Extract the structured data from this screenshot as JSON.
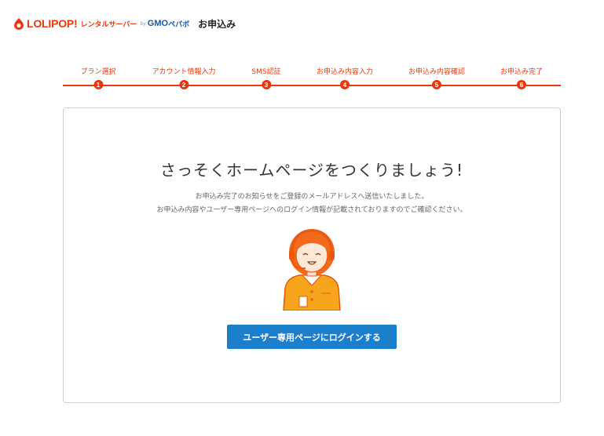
{
  "header": {
    "logo_main": "LOLIPOP!",
    "logo_sub": "レンタルサーバー",
    "logo_by": "by",
    "logo_gmo": "GMO",
    "logo_pepabo": "ペパボ",
    "page_title": "お申込み",
    "brand_color": "#e8380d"
  },
  "steps": [
    {
      "label": "プラン選択",
      "number": "1"
    },
    {
      "label": "アカウント情報入力",
      "number": "2"
    },
    {
      "label": "SMS認証",
      "number": "3"
    },
    {
      "label": "お申込み内容入力",
      "number": "4"
    },
    {
      "label": "お申込み内容確認",
      "number": "5"
    },
    {
      "label": "お申込み完了",
      "number": "6"
    }
  ],
  "card": {
    "title": "さっそくホームページをつくりましょう!",
    "desc_line1": "お申込み完了のお知らせをご登録のメールアドレスへ送信いたしました。",
    "desc_line2": "お申込み内容やユーザー専用ページへのログイン情報が記載されておりますのでご確認ください。",
    "login_button": "ユーザー専用ページにログインする",
    "button_color": "#1b7fcc"
  }
}
